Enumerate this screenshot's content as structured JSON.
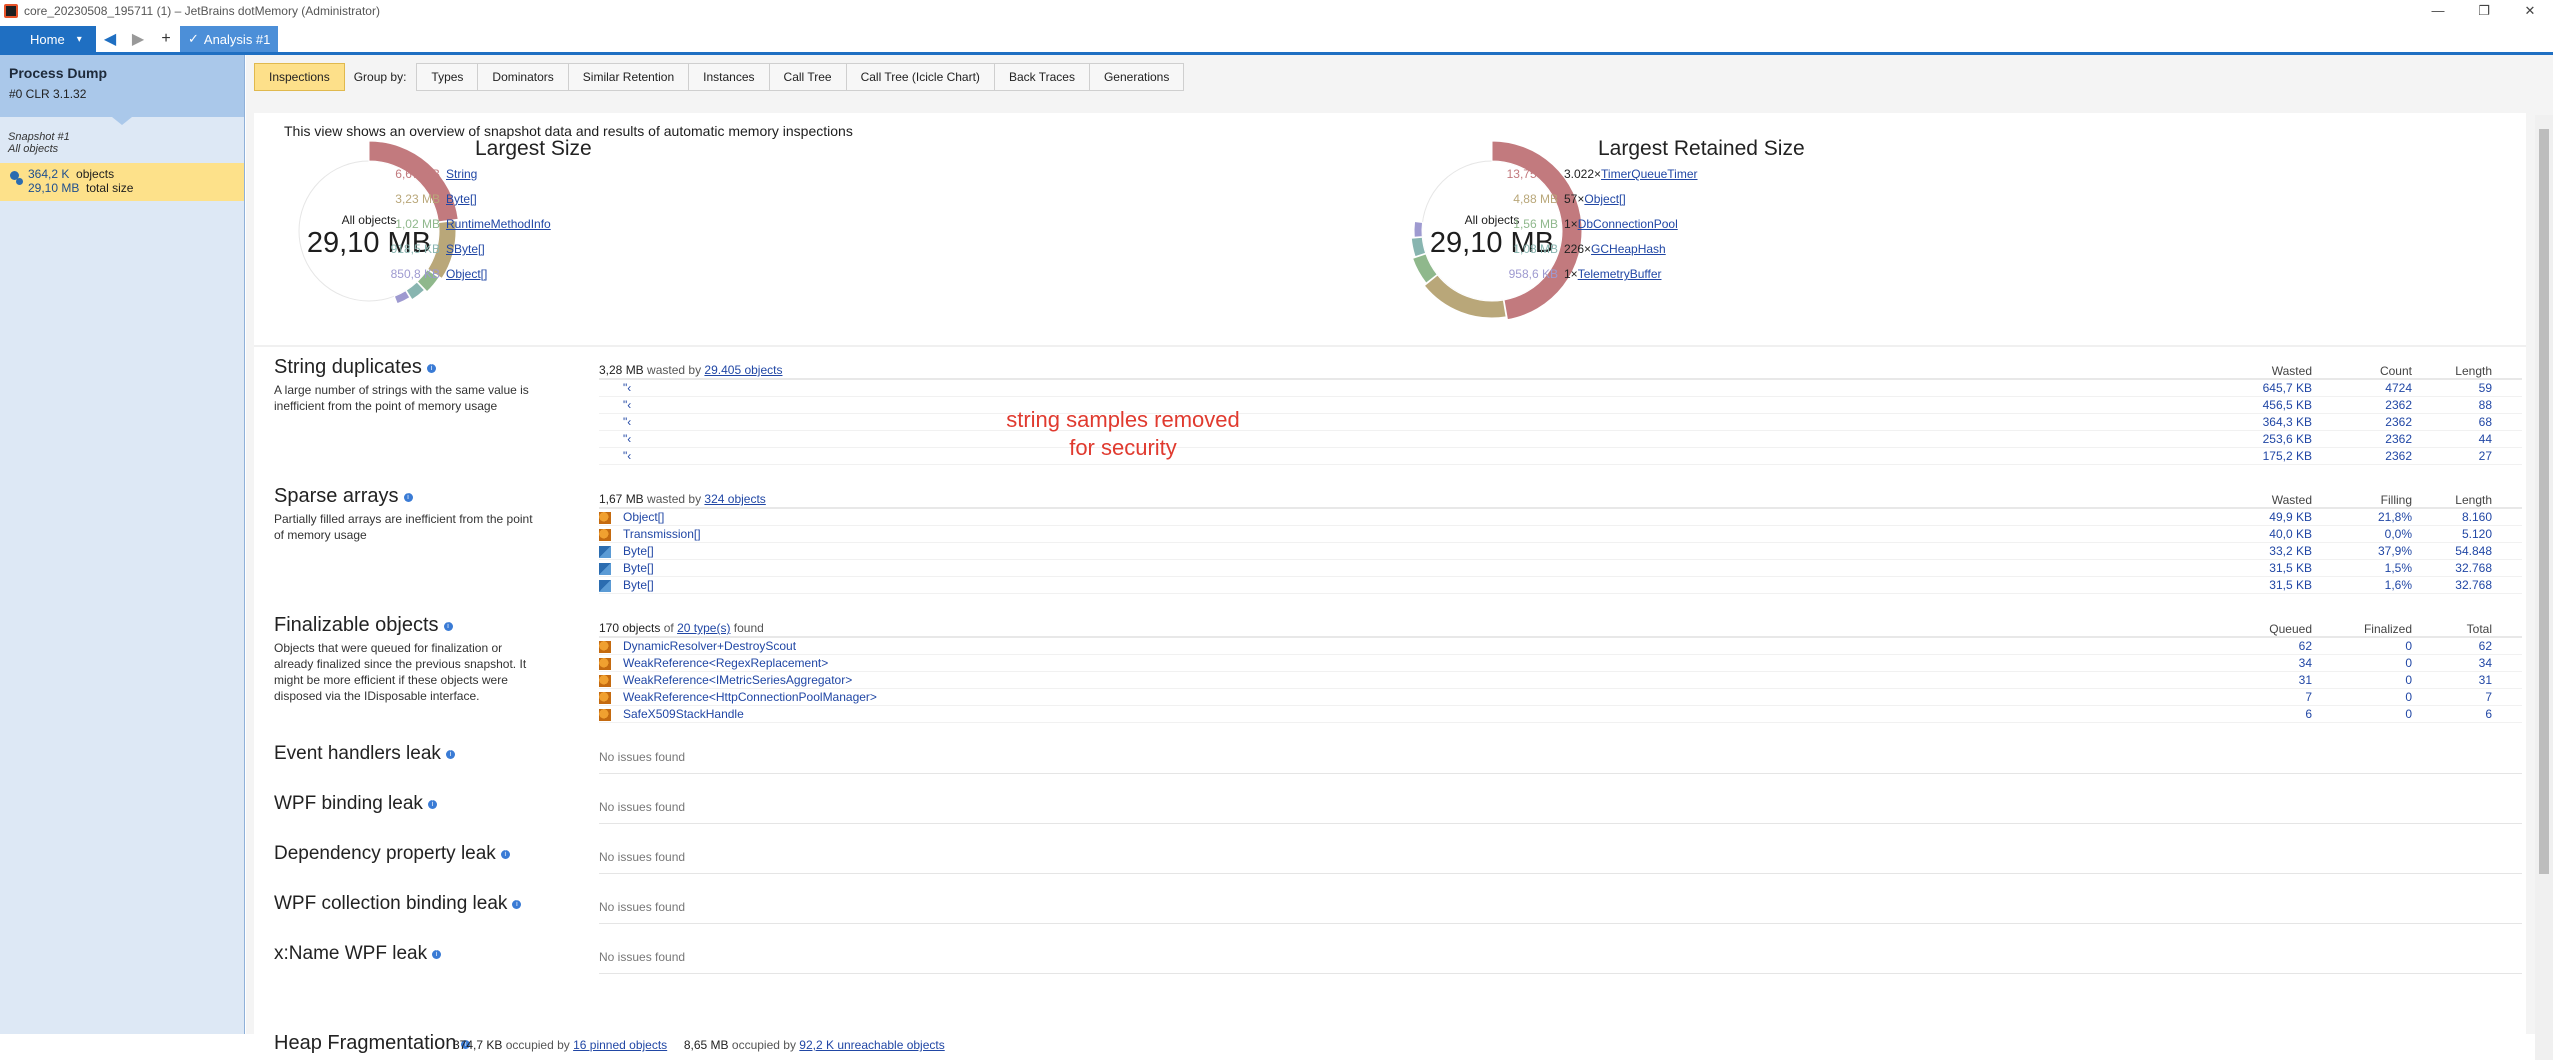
{
  "window": {
    "title": "core_20230508_195711 (1) – JetBrains dotMemory (Administrator)",
    "ctrl_min": "—",
    "ctrl_max": "❐",
    "ctrl_close": "✕"
  },
  "nav": {
    "home_label": "Home",
    "home_caret": "▾",
    "back": "◀",
    "forward": "▶",
    "add": "+",
    "analysis_check": "✓",
    "analysis_label": "Analysis #1"
  },
  "sidebar": {
    "process_title": "Process Dump",
    "process_sub": "#0 CLR 3.1.32",
    "snapshot_label": "Snapshot #1",
    "snapshot_sub": "All objects",
    "objects_count": "364,2 K",
    "objects_label": "objects",
    "total_size": "29,10 MB",
    "total_label": "total size"
  },
  "tabs": {
    "inspections": "Inspections",
    "group_by": "Group by:",
    "types": "Types",
    "dominators": "Dominators",
    "similar": "Similar Retention",
    "instances": "Instances",
    "calltree": "Call Tree",
    "icicle": "Call Tree (Icicle Chart)",
    "backtraces": "Back Traces",
    "generations": "Generations"
  },
  "intro": "This view shows an overview of snapshot data and results of automatic memory inspections",
  "largest_size": {
    "title": "Largest Size",
    "center_label": "All objects",
    "center_value": "29,10 MB",
    "items": [
      {
        "size": "6,67 MB",
        "name": "String",
        "color": "#c27a7e"
      },
      {
        "size": "3,23 MB",
        "name": "Byte[]",
        "color": "#b9a779"
      },
      {
        "size": "1,02 MB",
        "name": "RuntimeMethodInfo",
        "color": "#8fb88c"
      },
      {
        "size": "918,5 KB",
        "name": "SByte[]",
        "color": "#88b5b0"
      },
      {
        "size": "850,8 KB",
        "name": "Object[]",
        "color": "#9e9ad0"
      }
    ]
  },
  "largest_retained": {
    "title": "Largest Retained Size",
    "center_label": "All objects",
    "center_value": "29,10 MB",
    "items": [
      {
        "size": "13,75 MB",
        "count": "3.022×",
        "name": "TimerQueueTimer",
        "color": "#c27a7e"
      },
      {
        "size": "4,88 MB",
        "count": "57×",
        "name": "Object[]",
        "color": "#b9a779"
      },
      {
        "size": "1,56 MB",
        "count": "1×",
        "name": "DbConnectionPool",
        "color": "#8fb88c"
      },
      {
        "size": "1,08 MB",
        "count": "226×",
        "name": "GCHeapHash",
        "color": "#88b5b0"
      },
      {
        "size": "958,6 KB",
        "count": "1×",
        "name": "TelemetryBuffer",
        "color": "#9e9ad0"
      }
    ]
  },
  "string_dup": {
    "title": "String duplicates",
    "info": "i",
    "desc": "A large number of strings with the same value is inefficient from the point of memory usage",
    "meta_value": "3,28 MB",
    "meta_mid": "wasted by",
    "meta_link": "29.405 objects",
    "headers": [
      "Wasted",
      "Count",
      "Length"
    ],
    "redacted_note": "string samples removed for security",
    "rows": [
      {
        "name": "\"‹",
        "wasted": "645,7 KB",
        "count": "4724",
        "length": "59"
      },
      {
        "name": "\"‹",
        "wasted": "456,5 KB",
        "count": "2362",
        "length": "88"
      },
      {
        "name": "\"‹",
        "wasted": "364,3 KB",
        "count": "2362",
        "length": "68"
      },
      {
        "name": "\"‹",
        "wasted": "253,6 KB",
        "count": "2362",
        "length": "44"
      },
      {
        "name": "\"‹",
        "wasted": "175,2 KB",
        "count": "2362",
        "length": "27"
      }
    ]
  },
  "sparse": {
    "title": "Sparse arrays",
    "info": "i",
    "desc": "Partially filled arrays are inefficient from the point of memory usage",
    "meta_value": "1,67 MB",
    "meta_mid": "wasted by",
    "meta_link": "324 objects",
    "headers": [
      "Wasted",
      "Filling",
      "Length"
    ],
    "rows": [
      {
        "name": "Object[]",
        "wasted": "49,9 KB",
        "filling": "21,8%",
        "length": "8.160"
      },
      {
        "name": "Transmission[]",
        "wasted": "40,0 KB",
        "filling": "0,0%",
        "length": "5.120"
      },
      {
        "name": "Byte[]",
        "wasted": "33,2 KB",
        "filling": "37,9%",
        "length": "54.848"
      },
      {
        "name": "Byte[]",
        "wasted": "31,5 KB",
        "filling": "1,5%",
        "length": "32.768"
      },
      {
        "name": "Byte[]",
        "wasted": "31,5 KB",
        "filling": "1,6%",
        "length": "32.768"
      }
    ]
  },
  "finalizable": {
    "title": "Finalizable objects",
    "info": "i",
    "desc": "Objects that were queued for finalization or already finalized since the previous snapshot. It might be more efficient if these objects were disposed via the IDisposable interface.",
    "meta_value": "170 objects",
    "meta_mid": "of",
    "meta_link": "20 type(s)",
    "meta_tail": "found",
    "headers": [
      "Queued",
      "Finalized",
      "Total"
    ],
    "rows": [
      {
        "name": "DynamicResolver+DestroyScout",
        "queued": "62",
        "finalized": "0",
        "total": "62"
      },
      {
        "name": "WeakReference<RegexReplacement>",
        "queued": "34",
        "finalized": "0",
        "total": "34"
      },
      {
        "name": "WeakReference<IMetricSeriesAggregator>",
        "queued": "31",
        "finalized": "0",
        "total": "31"
      },
      {
        "name": "WeakReference<HttpConnectionPoolManager>",
        "queued": "7",
        "finalized": "0",
        "total": "7"
      },
      {
        "name": "SafeX509StackHandle",
        "queued": "6",
        "finalized": "0",
        "total": "6"
      }
    ]
  },
  "leaks": [
    {
      "title": "Event handlers leak",
      "status": "No issues found"
    },
    {
      "title": "WPF binding leak",
      "status": "No issues found"
    },
    {
      "title": "Dependency property leak",
      "status": "No issues found"
    },
    {
      "title": "WPF collection binding leak",
      "status": "No issues found"
    },
    {
      "title": "x:Name WPF leak",
      "status": "No issues found"
    }
  ],
  "info_glyph": "i",
  "heap": {
    "title": "Heap Fragmentation",
    "pinned_value": "374,7 KB",
    "pinned_mid": "occupied by",
    "pinned_link": "16 pinned objects",
    "unreach_value": "8,65 MB",
    "unreach_mid": "occupied by",
    "unreach_link": "92,2 K unreachable objects"
  }
}
